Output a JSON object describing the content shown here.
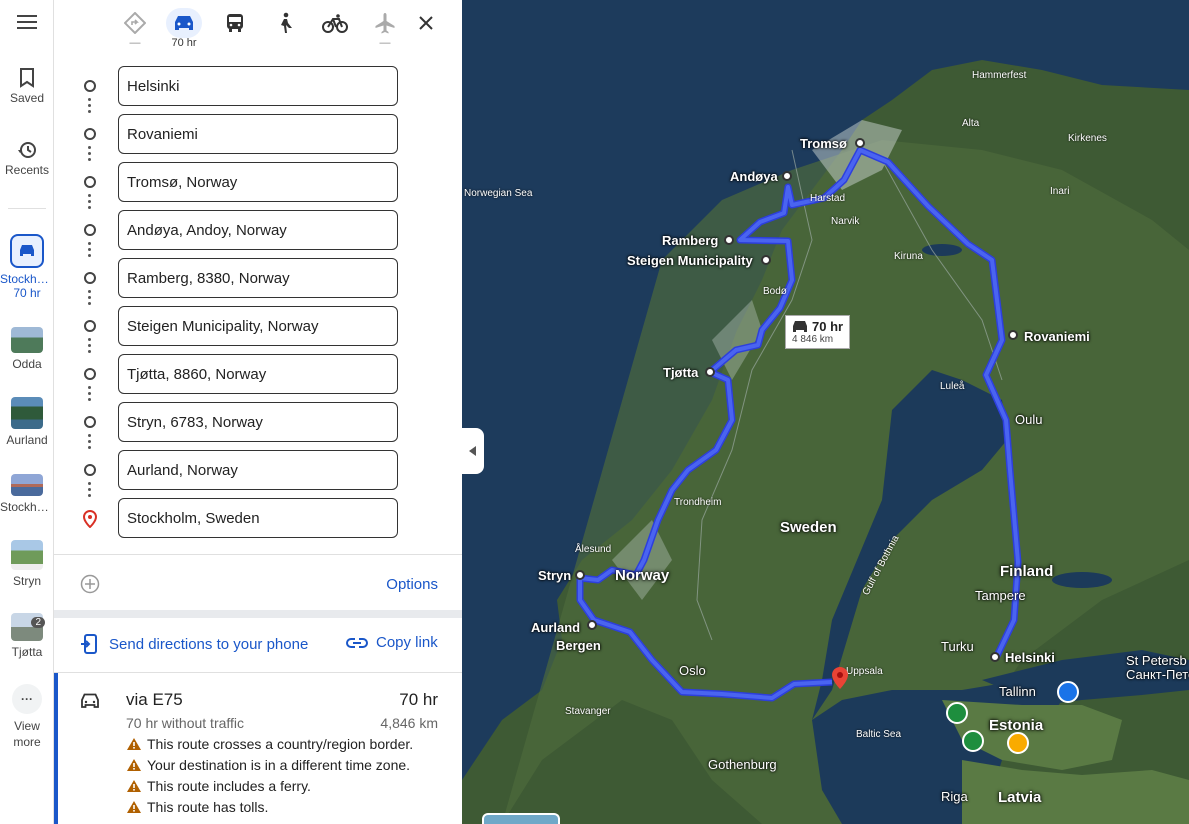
{
  "rail": {
    "menu_icon": "hamburger-menu-icon",
    "saved": "Saved",
    "recents": "Recents",
    "active_trip": {
      "label": "Stockho…",
      "sub": "70 hr"
    },
    "recent_places": [
      {
        "label": "Odda",
        "color": "#5b7c6a"
      },
      {
        "label": "Aurland",
        "color": "#3c6b8a"
      },
      {
        "label": "Stockho…",
        "color": "#6b6f9c"
      },
      {
        "label": "Stryn",
        "color": "#6f9b5a"
      },
      {
        "label": "Tjøtta",
        "color": "#7d7d7d",
        "badge": "2"
      }
    ],
    "view_more": "View more"
  },
  "modes": {
    "best_sub": "—",
    "drive_sub": "70 hr",
    "flight_sub": "—"
  },
  "stops": [
    "Helsinki",
    "Rovaniemi",
    "Tromsø, Norway",
    "Andøya, Andoy, Norway",
    "Ramberg, 8380, Norway",
    "Steigen Municipality, Norway",
    "Tjøtta, 8860, Norway",
    "Stryn, 6783, Norway",
    "Aurland, Norway",
    "Stockholm, Sweden"
  ],
  "options_label": "Options",
  "send_directions": "Send directions to your phone",
  "copy_link": "Copy link",
  "route": {
    "via": "via E75",
    "time": "70 hr",
    "traffic_note": "70 hr without traffic",
    "distance": "4,846 km",
    "warnings": [
      "This route crosses a country/region border.",
      "Your destination is in a different time zone.",
      "This route includes a ferry.",
      "This route has tolls."
    ]
  },
  "map": {
    "route_color": "#3a52e6",
    "callout": {
      "time": "70 hr",
      "distance": "4 846 km"
    },
    "places": {
      "tromso": "Tromsø",
      "andoya": "Andøya",
      "ramberg": "Ramberg",
      "steigen": "Steigen Municipality",
      "tjotta": "Tjøtta",
      "rovaniemi": "Rovaniemi",
      "oulu": "Oulu",
      "stryn": "Stryn",
      "norway": "Norway",
      "aurland": "Aurland",
      "bergen": "Bergen",
      "oslo": "Oslo",
      "helsinki": "Helsinki",
      "turku": "Turku",
      "tampere": "Tampere",
      "tallinn": "Tallinn",
      "estonia": "Estonia",
      "latvia": "Latvia",
      "riga": "Riga",
      "sweden": "Sweden",
      "finland": "Finland",
      "gothenburg": "Gothenburg",
      "st_petersburg": "St Petersb",
      "st_petersburg_ru": "Санкт-Пете",
      "uppsala": "Uppsala"
    },
    "small_places": {
      "hammerfest": "Hammerfest",
      "alta": "Alta",
      "kirkenes": "Kirkenes",
      "inari": "Inari",
      "harstad": "Harstad",
      "narvik": "Narvik",
      "kiruna": "Kiruna",
      "bodo": "Bodø",
      "lulea": "Luleå",
      "trondheim": "Trondheim",
      "alesund": "Ålesund",
      "stavanger": "Stavanger",
      "baltic": "Baltic Sea",
      "norwegian_sea": "Norwegian Sea",
      "gulf": "Gulf of Bothnia"
    }
  }
}
